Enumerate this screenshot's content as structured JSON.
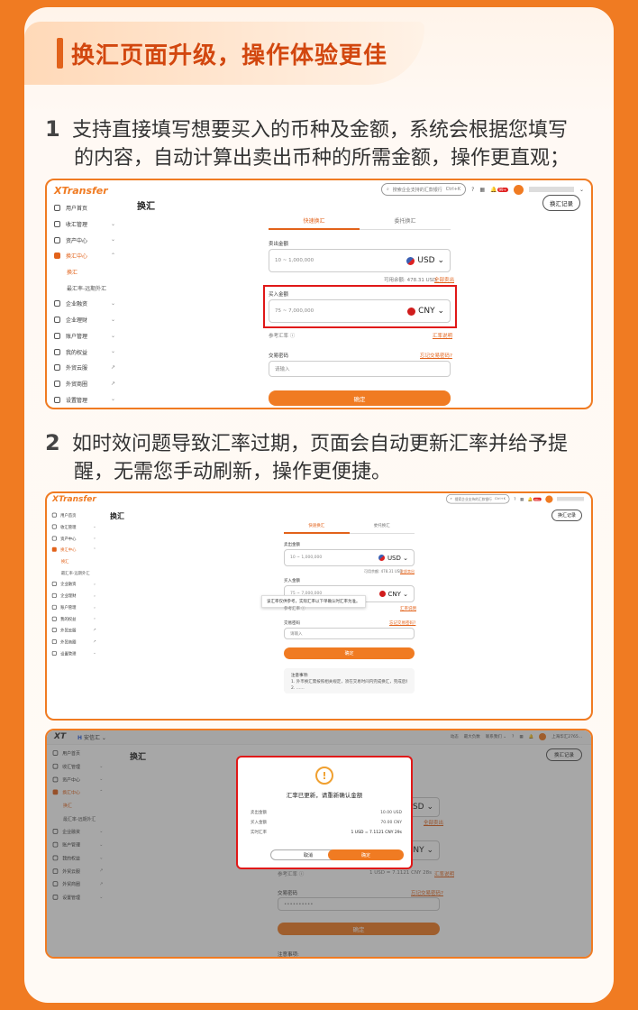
{
  "header": {
    "title": "换汇页面升级，操作体验更佳"
  },
  "steps": [
    {
      "num": "1",
      "line1": "支持直接填写想要买入的币种及金额，系统会根据您填写",
      "line2": "的内容，自动计算出卖出币种的所需金额，操作更直观；"
    },
    {
      "num": "2",
      "line1": "如时效问题导致汇率过期，页面会自动更新汇率并给予提",
      "line2": "醒，无需您手动刷新，操作更便捷。"
    }
  ],
  "app": {
    "brand": "XTransfer",
    "brand_alt": "XT",
    "brand_alt2": "安信汇",
    "page_title": "换汇",
    "record_button": "换汇记录",
    "search_placeholder": "搜索企业支持的汇款银行",
    "search_shortcut": "Ctrl+K",
    "notify_badge": "99+",
    "sidebar": [
      {
        "label": "用户首页",
        "arrow": ""
      },
      {
        "label": "收汇管理",
        "arrow": "⌄"
      },
      {
        "label": "资产中心",
        "arrow": "⌄"
      },
      {
        "label": "换汇中心",
        "arrow": "⌃",
        "active": true
      },
      {
        "label": "换汇",
        "sub": true,
        "active": true
      },
      {
        "label": "最汇率-远期外汇",
        "sub": true
      },
      {
        "label": "企业融资",
        "arrow": "⌄"
      },
      {
        "label": "企业理财",
        "arrow": "⌄"
      },
      {
        "label": "账户管理",
        "arrow": "⌄"
      },
      {
        "label": "我的权益",
        "arrow": "⌄"
      },
      {
        "label": "外贸云服",
        "arrow": "↗"
      },
      {
        "label": "外贸商圈",
        "arrow": "↗"
      },
      {
        "label": "设置管理",
        "arrow": "⌄"
      }
    ],
    "tabs": [
      "快速换汇",
      "委托换汇"
    ],
    "sell_label": "卖出金额",
    "sell_placeholder": "10 ~ 1,000,000",
    "sell_currency": "USD",
    "available_text": "可用余额: 478.31 USD",
    "sell_all": "全部卖出",
    "buy_label": "买入金额",
    "buy_placeholder": "75 ~ 7,000,000",
    "buy_currency": "CNY",
    "ref_rate": "参考汇率",
    "rate_desc": "汇率说明",
    "pwd_label": "交易密码",
    "pwd_forgot": "忘记交易密码?",
    "pwd_placeholder": "请输入",
    "pwd_masked": "••••••••••",
    "confirm": "确定",
    "tooltip": "该汇率仅供参考，实际汇率以下单确认时汇率为准。",
    "notes_title": "注意事项:",
    "notes_line1": "1. 外币换汇需按照相关规定，须在交易时间内完成换汇，完成后将即时入账。",
    "notes_line2": "2. ……",
    "topbar3": [
      "动态",
      "最大负数",
      "联系我们 ⌄"
    ],
    "user3": "上海华汇2765...",
    "modal": {
      "icon": "!",
      "title": "汇率已更新，请重新确认金额",
      "rows": [
        [
          "卖出金额",
          "10.00 USD"
        ],
        [
          "买入金额",
          "70.00 CNY"
        ],
        [
          "实时汇率",
          "1 USD = 7.1121 CNY  29s"
        ]
      ],
      "cancel": "取消",
      "ok": "确定"
    },
    "rate3": "1 USD = 7.1121 CNY  28s"
  }
}
